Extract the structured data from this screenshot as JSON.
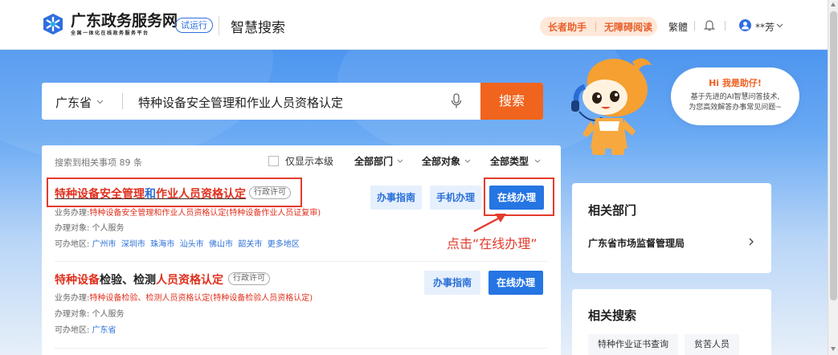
{
  "header": {
    "site_name": "广东政务服务网",
    "site_sub": "全国一体化在线政务服务平台",
    "trial_badge": "试运行",
    "section_title": "智慧搜索",
    "elder_mode": "长者助手",
    "accessible": "无障碍阅读",
    "traditional": "繁體",
    "user_name": "**芳"
  },
  "search": {
    "region": "广东省",
    "query": "特种设备安全管理和作业人员资格认定",
    "button": "搜索"
  },
  "assistant": {
    "greeting": "Hi 我是助仔!",
    "line1": "基于先进的AI智慧问答技术,",
    "line2": "为您高效解答办事常见问题~"
  },
  "results": {
    "count_text": "搜索到相关事项 89 条",
    "only_local": "仅显示本级",
    "filters": [
      "全部部门",
      "全部对象",
      "全部类型"
    ],
    "items": [
      {
        "title_a": "特种设备安全管理",
        "title_b": "和",
        "title_c": "作业人员资格认定",
        "tag": "行政许可",
        "biz_label": "业务办理:",
        "biz_text": "特种设备安全管理和作业人员资格认定(特种设备作业人员证复审)",
        "target_label": "办理对象:",
        "target": "个人服务",
        "area_label": "可办地区:",
        "areas": [
          "广州市",
          "深圳市",
          "珠海市",
          "汕头市",
          "佛山市",
          "韶关市",
          "更多地区"
        ],
        "btn_guide": "办事指南",
        "btn_mobile": "手机办理",
        "btn_online": "在线办理"
      },
      {
        "title_a": "特种设备",
        "title_b": "检验、检测",
        "title_c": "人员资格认定",
        "tag": "行政许可",
        "biz_label": "业务办理:",
        "biz_text": "特种设备检验、检测人员资格认定(特种设备检验人员资格认定)",
        "target_label": "办理对象:",
        "target": "个人服务",
        "area_label": "可办地区:",
        "areas": [
          "广东省"
        ],
        "btn_guide": "办事指南",
        "btn_online": "在线办理"
      }
    ]
  },
  "annotation": {
    "text": "点击“在线办理”"
  },
  "sidebar": {
    "dept_title": "相关部门",
    "dept_item": "广东省市场监督管理局",
    "related_title": "相关搜索",
    "related_tags": [
      "特种作业证书查询",
      "贫苦人员"
    ]
  }
}
